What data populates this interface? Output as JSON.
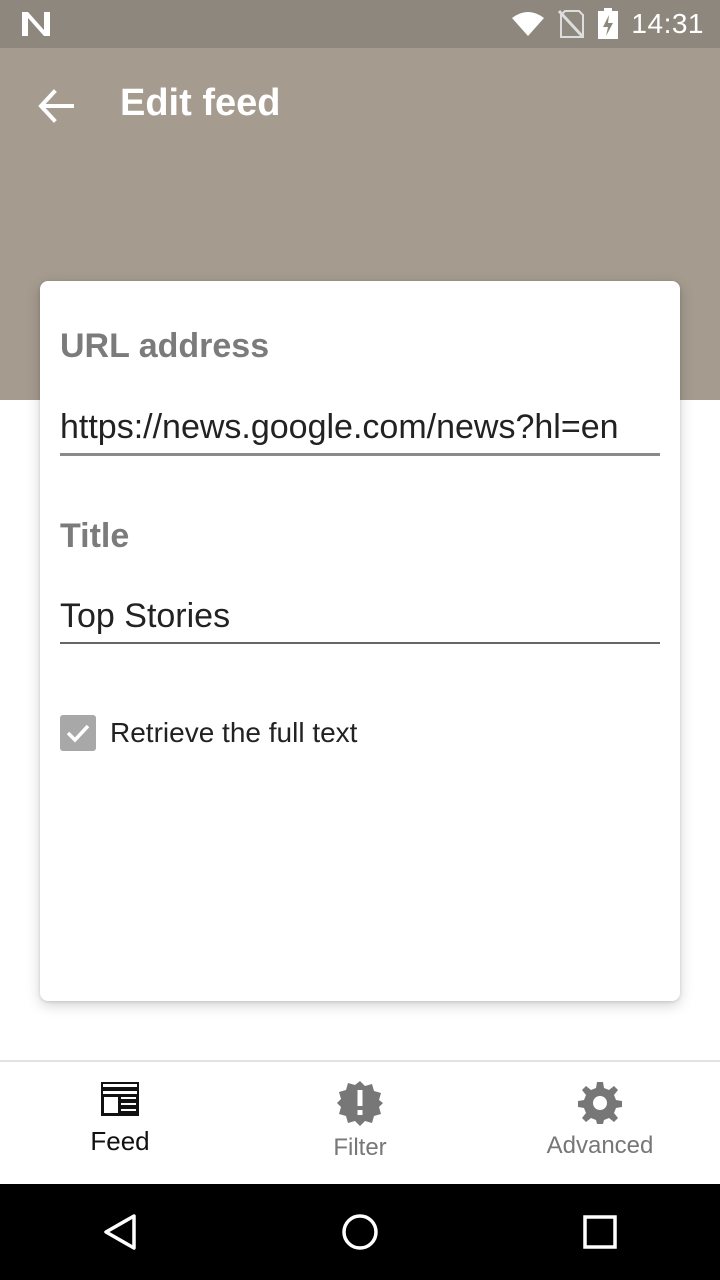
{
  "status_bar": {
    "time": "14:31",
    "icons": [
      "n-notification-icon",
      "wifi-icon",
      "no-sim-icon",
      "battery-charging-icon"
    ]
  },
  "app_bar": {
    "title": "Edit feed",
    "back_icon": "arrow-left-icon",
    "background": "#a59b8f"
  },
  "form": {
    "url_label": "URL address",
    "url_value": "https://news.google.com/news?hl=en",
    "title_label": "Title",
    "title_value": "Top Stories",
    "full_text_label": "Retrieve the full text",
    "full_text_checked": true
  },
  "bottom_nav": {
    "items": [
      {
        "label": "Feed",
        "icon": "feed-icon",
        "active": true
      },
      {
        "label": "Filter",
        "icon": "alert-badge-icon",
        "active": false
      },
      {
        "label": "Advanced",
        "icon": "gear-icon",
        "active": false
      }
    ]
  },
  "system_nav": {
    "icons": [
      "back-triangle-icon",
      "home-circle-icon",
      "recents-square-icon"
    ]
  }
}
